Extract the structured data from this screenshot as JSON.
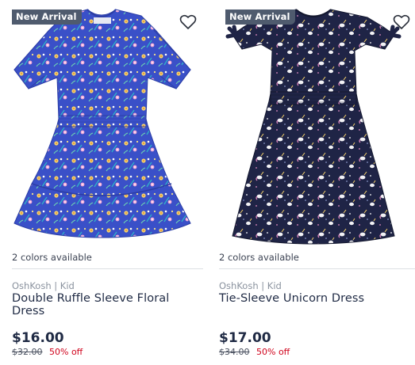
{
  "products": [
    {
      "badge": "New Arrival",
      "colors_available": "2 colors available",
      "brand": "OshKosh | Kid",
      "title": "Double Ruffle Sleeve Floral Dress",
      "price": "$16.00",
      "original_price": "$32.00",
      "discount": "50% off",
      "dress_color": "#3a50c8",
      "pattern": "floral"
    },
    {
      "badge": "New Arrival",
      "colors_available": "2 colors available",
      "brand": "OshKosh | Kid",
      "title": "Tie-Sleeve Unicorn Dress",
      "price": "$17.00",
      "original_price": "$34.00",
      "discount": "50% off",
      "dress_color": "#1f2446",
      "pattern": "unicorn"
    }
  ],
  "colors": {
    "badge_bg": "#4f5b6e",
    "sale": "#d0021b",
    "text": "#1f2a44"
  },
  "icons": {
    "favorite": "heart-outline-icon"
  }
}
